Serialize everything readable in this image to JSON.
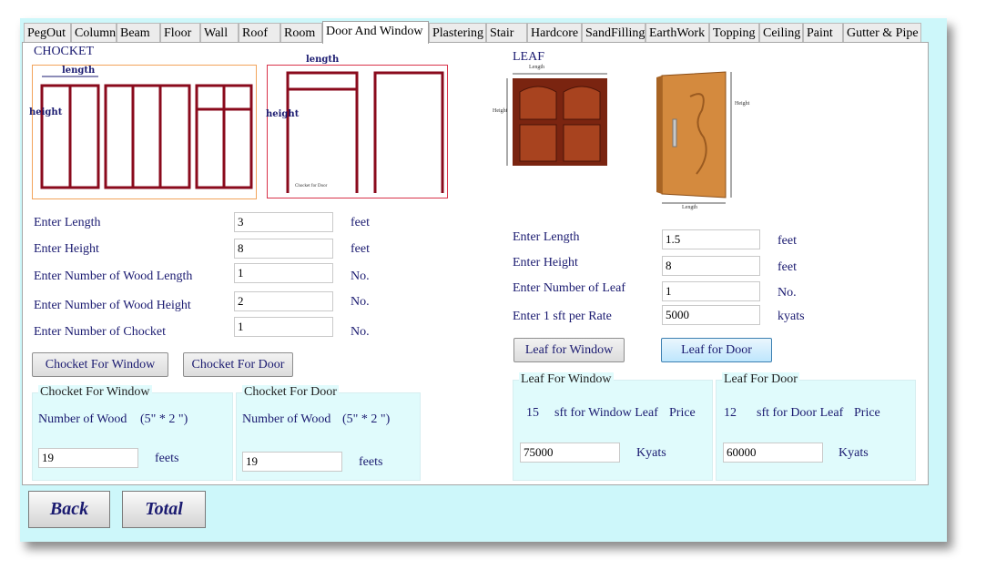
{
  "tabs": [
    "PegOut",
    "Column",
    "Beam",
    "Floor",
    "Wall",
    "Roof",
    "Room",
    "Door And Window",
    "Plastering",
    "Stair",
    "Hardcore",
    "SandFilling",
    "EarthWork",
    "Topping",
    "Ceiling",
    "Paint",
    "Gutter & Pipe"
  ],
  "active_tab": "Door And Window",
  "chocket": {
    "title": "CHOCKET",
    "diagram": {
      "length": "length",
      "height": "height",
      "height2": "height",
      "length2": "length",
      "caption": "Chocket for Door"
    },
    "length_label": "Enter Length",
    "length_value": "3",
    "length_unit": "feet",
    "height_label": "Enter Height",
    "height_value": "8",
    "height_unit": "feet",
    "wood_length_label": "Enter Number of Wood Length",
    "wood_length_value": "1",
    "wood_length_unit": "No.",
    "wood_height_label": "Enter Number of Wood Height",
    "wood_height_value": "2",
    "wood_height_unit": "No.",
    "count_label": "Enter Number of Chocket",
    "count_value": "1",
    "count_unit": "No.",
    "window_button": "Chocket For Window",
    "door_button": "Chocket For Door",
    "window_group": {
      "title": "Chocket For Window",
      "label": "Number of Wood",
      "size": "(5\" * 2 \")",
      "value": "19",
      "unit": "feets"
    },
    "door_group": {
      "title": "Chocket For Door",
      "label": "Number of Wood",
      "size": "(5\" * 2 \")",
      "value": "19",
      "unit": "feets"
    }
  },
  "leaf": {
    "title": "LEAF",
    "diagram": {
      "length": "Length",
      "height": "Height",
      "height2": "Height",
      "length2": "Length"
    },
    "length_label": "Enter Length",
    "length_value": "1.5",
    "length_unit": "feet",
    "height_label": "Enter Height",
    "height_value": "8",
    "height_unit": "feet",
    "count_label": "Enter Number of Leaf",
    "count_value": "1",
    "count_unit": "No.",
    "rate_label": "Enter 1 sft per Rate",
    "rate_value": "5000",
    "rate_unit": "kyats",
    "window_button": "Leaf for Window",
    "door_button": "Leaf for Door",
    "window_group": {
      "title": "Leaf For Window",
      "sft": "15",
      "sft_text": "sft for Window Leaf",
      "price_label": "Price",
      "value": "75000",
      "unit": "Kyats"
    },
    "door_group": {
      "title": "Leaf For Door",
      "sft": "12",
      "sft_text": "sft for Door Leaf",
      "price_label": "Price",
      "value": "60000",
      "unit": "Kyats"
    }
  },
  "footer": {
    "back": "Back",
    "total": "Total"
  }
}
